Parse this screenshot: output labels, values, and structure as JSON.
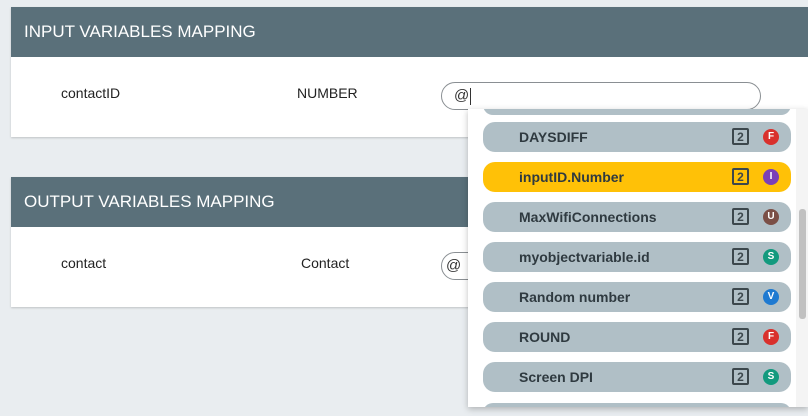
{
  "input_panel": {
    "title": "INPUT VARIABLES MAPPING",
    "row": {
      "name": "contactID",
      "type": "NUMBER",
      "value": "@"
    }
  },
  "output_panel": {
    "title": "OUTPUT VARIABLES MAPPING",
    "row": {
      "name": "contact",
      "type": "Contact",
      "value": "@"
    }
  },
  "dropdown": {
    "items": [
      {
        "label": "DAYSDIFF",
        "type_glyph": "2",
        "badge": "F",
        "badge_color": "#d9302c",
        "selected": false
      },
      {
        "label": "inputID.Number",
        "type_glyph": "2",
        "badge": "I",
        "badge_color": "#7b3fb7",
        "selected": true
      },
      {
        "label": "MaxWifiConnections",
        "type_glyph": "2",
        "badge": "U",
        "badge_color": "#7b4f46",
        "selected": false
      },
      {
        "label": "myobjectvariable.id",
        "type_glyph": "2",
        "badge": "S",
        "badge_color": "#139a7e",
        "selected": false
      },
      {
        "label": "Random number",
        "type_glyph": "2",
        "badge": "V",
        "badge_color": "#1f7ad1",
        "selected": false
      },
      {
        "label": "ROUND",
        "type_glyph": "2",
        "badge": "F",
        "badge_color": "#d9302c",
        "selected": false
      },
      {
        "label": "Screen DPI",
        "type_glyph": "2",
        "badge": "S",
        "badge_color": "#139a7e",
        "selected": false
      }
    ]
  }
}
